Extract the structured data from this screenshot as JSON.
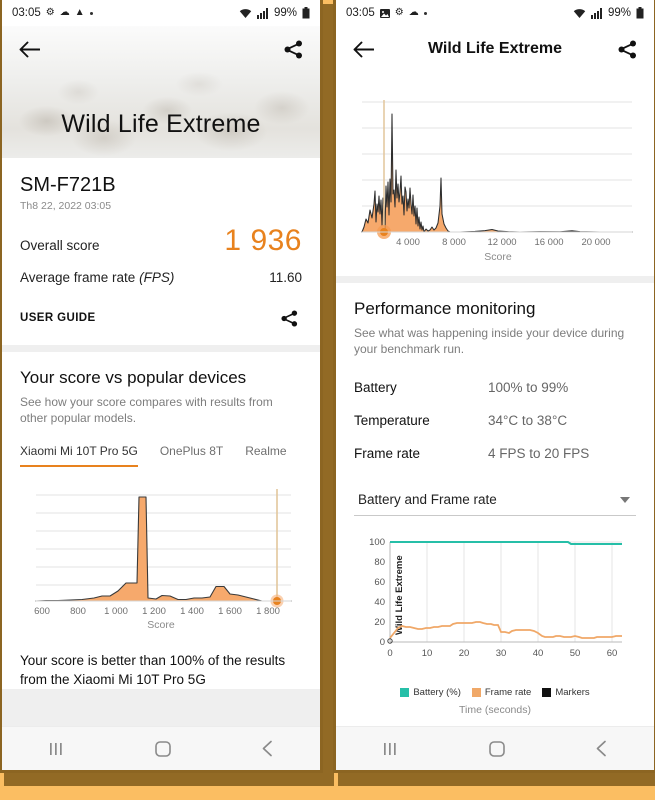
{
  "background": {
    "bezel": "#FBBE62",
    "shadow": "#8C6522"
  },
  "colors": {
    "accent": "#E8821E",
    "battery": "#26BFA8",
    "framerate": "#F0A868",
    "markers": "#111111"
  },
  "left_phone": {
    "statusbar": {
      "time": "03:05",
      "icons": [
        "gear-icon",
        "cloud-icon",
        "warning-icon",
        "dot-icon"
      ],
      "wifi": "wifi-icon",
      "signal": "signal-icon",
      "battery_text": "99%"
    },
    "appbar": {
      "back": "back-arrow-icon",
      "share": "share-icon"
    },
    "hero_title": "Wild Life Extreme",
    "score_card": {
      "device": "SM-F721B",
      "date": "Th8 22, 2022 03:05",
      "overall_label": "Overall score",
      "overall_value": "1 936",
      "fps_label": "Average frame rate",
      "fps_label_italic": "(FPS)",
      "fps_value": "11.60",
      "user_guide": "USER GUIDE",
      "share_icon": "share-icon"
    },
    "compare_card": {
      "title": "Your score vs popular devices",
      "subtitle": "See how your score compares with results from other popular models.",
      "tabs": [
        {
          "label": "Xiaomi Mi 10T Pro 5G",
          "active": true
        },
        {
          "label": "OnePlus 8T",
          "active": false
        },
        {
          "label": "Realme",
          "active": false
        }
      ],
      "footnote": "Your score is better than 100% of the results from the Xiaomi Mi 10T Pro 5G"
    }
  },
  "right_phone": {
    "statusbar": {
      "time": "03:05",
      "icons": [
        "image-icon",
        "gear-icon",
        "cloud-icon",
        "dot-icon"
      ],
      "wifi": "wifi-icon",
      "signal": "signal-icon",
      "battery_text": "99%"
    },
    "appbar": {
      "back": "back-arrow-icon",
      "title": "Wild Life Extreme",
      "share": "share-icon"
    },
    "perf_card": {
      "title": "Performance monitoring",
      "subtitle": "See what was happening inside your device during your benchmark run.",
      "rows": [
        {
          "key": "Battery",
          "value": "100% to 99%"
        },
        {
          "key": "Temperature",
          "value": "34°C to 38°C"
        },
        {
          "key": "Frame rate",
          "value": "4 FPS to 20 FPS"
        }
      ],
      "select_value": "Battery and Frame rate",
      "caret": "chevron-down-icon"
    }
  },
  "navbar": {
    "recents": "recents-icon",
    "home": "home-icon",
    "back": "back-icon"
  },
  "chart_data": [
    {
      "id": "left_histogram",
      "type": "area",
      "title": "",
      "xlabel": "Score",
      "ylabel": "",
      "xlim": [
        520,
        1990
      ],
      "ylim": [
        0,
        100
      ],
      "xticks": [
        600,
        800,
        1000,
        1200,
        1400,
        1600,
        1800
      ],
      "xticklabels": [
        "600",
        "800",
        "1 000",
        "1 200",
        "1 400",
        "1 600",
        "1 800"
      ],
      "grid": true,
      "marker_x": 1936,
      "marker_label": "1 936",
      "x": [
        560,
        620,
        680,
        740,
        800,
        860,
        900,
        940,
        980,
        1020,
        1060,
        1100,
        1140,
        1180,
        1220,
        1260,
        1300,
        1340,
        1380,
        1420,
        1460,
        1500,
        1540,
        1580,
        1620,
        1680
      ],
      "values": [
        1,
        1,
        1,
        2,
        2,
        3,
        5,
        5,
        9,
        18,
        18,
        92,
        5,
        4,
        7,
        5,
        3,
        3,
        4,
        6,
        13,
        13,
        7,
        5,
        3,
        0
      ]
    },
    {
      "id": "right_histogram",
      "type": "area",
      "title": "",
      "xlabel": "Score",
      "ylabel": "",
      "xlim": [
        0,
        23500
      ],
      "ylim": [
        0,
        100
      ],
      "xticks": [
        4000,
        8000,
        12000,
        16000,
        20000
      ],
      "xticklabels": [
        "4 000",
        "8 000",
        "12 000",
        "16 000",
        "20 000"
      ],
      "grid": true,
      "marker_x": 1936,
      "x": [
        200,
        420,
        620,
        820,
        1000,
        1150,
        1300,
        1450,
        1600,
        1750,
        1900,
        2050,
        2200,
        2350,
        2500,
        2650,
        2800,
        2950,
        3100,
        3250,
        3400,
        3600,
        3800,
        4000,
        4200,
        4400,
        4600,
        4800,
        5000,
        5200,
        5400,
        6500,
        8000,
        9500,
        10000,
        10500,
        12000,
        16000,
        19500,
        20500,
        22000
      ],
      "values": [
        8,
        20,
        14,
        34,
        22,
        46,
        28,
        90,
        30,
        62,
        26,
        44,
        33,
        20,
        52,
        18,
        44,
        14,
        10,
        6,
        24,
        12,
        4,
        6,
        5,
        4,
        6,
        22,
        52,
        14,
        2,
        1,
        1,
        2,
        3,
        2,
        1,
        1,
        2,
        1,
        0
      ]
    },
    {
      "id": "performance_monitor",
      "type": "line",
      "title": "",
      "xlabel": "Time (seconds)",
      "ylabel": "Wild Life Extreme",
      "xlim": [
        0,
        61
      ],
      "ylim": [
        0,
        105
      ],
      "xticks": [
        0,
        10,
        20,
        30,
        40,
        50,
        60
      ],
      "yticks": [
        0,
        20,
        40,
        60,
        80,
        100
      ],
      "grid": true,
      "legend_position": "bottom",
      "legend": [
        "Battery (%)",
        "Frame rate",
        "Markers"
      ],
      "series": [
        {
          "name": "Battery (%)",
          "color": "#26BFA8",
          "x": [
            0,
            10,
            20,
            30,
            40,
            47,
            48.5,
            50,
            60,
            61
          ],
          "values": [
            100,
            100,
            100,
            100,
            100,
            100,
            100,
            99,
            99,
            99
          ]
        },
        {
          "name": "Frame rate",
          "color": "#F0A868",
          "x": [
            0,
            1,
            2,
            3,
            4,
            5,
            6,
            7,
            8,
            9,
            10,
            11,
            12,
            13,
            14,
            15,
            16,
            17,
            18,
            19,
            20,
            21,
            22,
            23,
            24,
            25,
            26,
            27,
            28,
            29,
            30,
            31,
            32,
            33,
            34,
            35,
            36,
            37,
            38,
            39,
            40,
            41,
            42,
            43,
            44,
            45,
            46,
            47,
            48,
            49,
            50,
            51,
            52,
            53,
            54,
            55,
            56,
            57,
            58,
            59,
            60,
            61
          ],
          "values": [
            4,
            9,
            14,
            16,
            15,
            15,
            14,
            13,
            13,
            14,
            14,
            15,
            15,
            16,
            16,
            16,
            18,
            19,
            19,
            19,
            19,
            19,
            20,
            20,
            19,
            18,
            18,
            17,
            17,
            10,
            10,
            9,
            11,
            12,
            12,
            12,
            12,
            12,
            11,
            9,
            6,
            5,
            5,
            5,
            6,
            6,
            5,
            5,
            5,
            6,
            5,
            4,
            4,
            4,
            4,
            5,
            5,
            5,
            5,
            5,
            6,
            6
          ]
        }
      ]
    }
  ]
}
